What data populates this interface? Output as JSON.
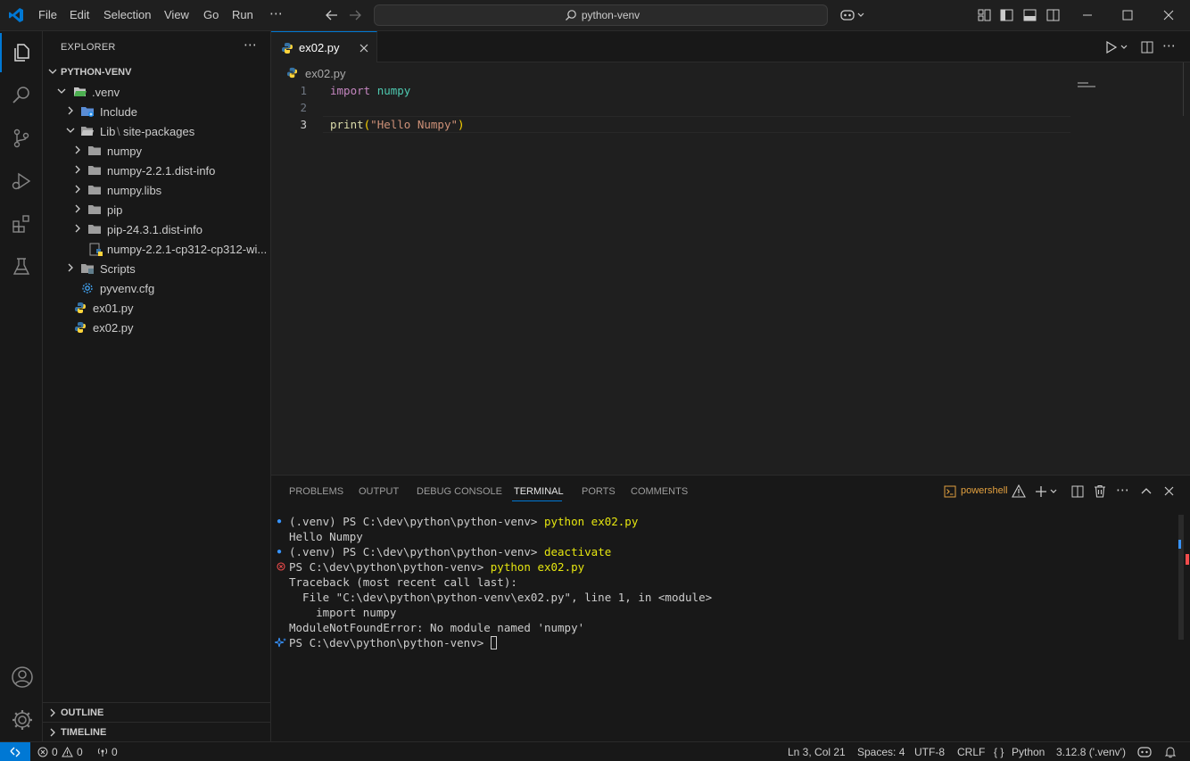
{
  "titlebar": {
    "menu": [
      "File",
      "Edit",
      "Selection",
      "View",
      "Go",
      "Run",
      "⋯"
    ],
    "search_text": "python-venv"
  },
  "sidebar": {
    "title": "EXPLORER",
    "root": "PYTHON-VENV",
    "tree": [
      {
        "label": ".venv"
      },
      {
        "label": "Include"
      },
      {
        "label": "Lib",
        "sub": "site-packages"
      },
      {
        "label": "numpy"
      },
      {
        "label": "numpy-2.2.1.dist-info"
      },
      {
        "label": "numpy.libs"
      },
      {
        "label": "pip"
      },
      {
        "label": "pip-24.3.1.dist-info"
      },
      {
        "label": "numpy-2.2.1-cp312-cp312-wi..."
      },
      {
        "label": "Scripts"
      },
      {
        "label": "pyvenv.cfg"
      },
      {
        "label": "ex01.py"
      },
      {
        "label": "ex02.py"
      }
    ],
    "outline": "OUTLINE",
    "timeline": "TIMELINE"
  },
  "editor": {
    "tab_label": "ex02.py",
    "breadcrumb": "ex02.py",
    "line_numbers": [
      "1",
      "2",
      "3"
    ],
    "code": {
      "l1_kw": "import",
      "l1_mod": "numpy",
      "l3_fn": "print",
      "l3_open": "(",
      "l3_str": "\"Hello Numpy\"",
      "l3_close": ")"
    }
  },
  "panel": {
    "tabs": [
      "PROBLEMS",
      "OUTPUT",
      "DEBUG CONSOLE",
      "TERMINAL",
      "PORTS",
      "COMMENTS"
    ],
    "active_tab": "TERMINAL",
    "shell_label": "powershell",
    "terminal": {
      "l1_prompt": "(.venv) PS C:\\dev\\python\\python-venv> ",
      "l1_cmd": "python ex02.py",
      "l2": "Hello Numpy",
      "l3_prompt": "(.venv) PS C:\\dev\\python\\python-venv> ",
      "l3_cmd": "deactivate",
      "l4_prompt": "PS C:\\dev\\python\\python-venv> ",
      "l4_cmd": "python ex02.py",
      "l5": "Traceback (most recent call last):",
      "l6": "  File \"C:\\dev\\python\\python-venv\\ex02.py\", line 1, in <module>",
      "l7": "    import numpy",
      "l8": "ModuleNotFoundError: No module named 'numpy'",
      "l9_prompt": "PS C:\\dev\\python\\python-venv> "
    }
  },
  "statusbar": {
    "errors": "0",
    "warnings": "0",
    "ports": "0",
    "position": "Ln 3, Col 21",
    "spaces": "Spaces: 4",
    "encoding": "UTF-8",
    "eol": "CRLF",
    "lang_braces": "{ }",
    "language": "Python",
    "interpreter": "3.12.8 ('.venv')"
  },
  "colors": {
    "accent": "#0078d4",
    "keyword": "#c586c0",
    "module": "#4ec9b0",
    "function": "#dcdcaa",
    "string": "#ce9178",
    "cmd": "#e5e510",
    "folder": "#c5c5c5",
    "python_blue": "#3572a5",
    "python_yellow": "#ffd43b",
    "error": "#f14c4c"
  }
}
